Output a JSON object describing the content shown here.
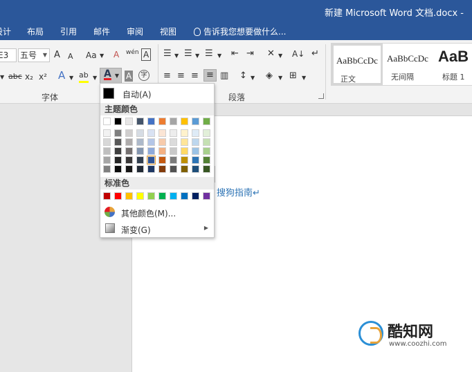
{
  "window": {
    "title": "新建 Microsoft Word 文档.docx -"
  },
  "tabs": [
    {
      "label": "设计"
    },
    {
      "label": "布局"
    },
    {
      "label": "引用"
    },
    {
      "label": "邮件"
    },
    {
      "label": "审阅"
    },
    {
      "label": "视图"
    }
  ],
  "tell_me": "告诉我您想要做什么...",
  "ribbon": {
    "font_name": "E3",
    "font_size": "五号",
    "grow_font": "A",
    "shrink_font": "A",
    "change_case": "Aa",
    "clear_format": "A",
    "phonetic": "wén",
    "border_char": "A",
    "strikethrough": "abc",
    "subscript": "x₂",
    "superscript": "x²",
    "text_effect": "A",
    "highlight": "ab",
    "font_color": "A",
    "char_shading": "A",
    "enclose_char": "字",
    "sort": "A↓",
    "group_font": "字体",
    "group_paragraph": "段落"
  },
  "styles": [
    {
      "sample": "AaBbCcDc",
      "name": "正文",
      "selected": true
    },
    {
      "sample": "AaBbCcDc",
      "name": "无间隔",
      "selected": false
    },
    {
      "sample": "AaB",
      "name": "标题 1",
      "selected": false
    }
  ],
  "document": {
    "text": "搜狗指南"
  },
  "color_menu": {
    "auto_label": "自动(A)",
    "theme_header": "主题颜色",
    "standard_header": "标准色",
    "more_colors": "其他颜色(M)...",
    "gradient": "渐变(G)",
    "theme_top": [
      "#ffffff",
      "#000000",
      "#e7e6e6",
      "#44546a",
      "#4472c4",
      "#ed7d31",
      "#a5a5a5",
      "#ffc000",
      "#5b9bd5",
      "#70ad47"
    ],
    "theme_shades": [
      [
        "#f2f2f2",
        "#7f7f7f",
        "#d0cece",
        "#d6dce4",
        "#d9e2f3",
        "#fbe5d5",
        "#ededed",
        "#fff2cc",
        "#deebf6",
        "#e2efd9"
      ],
      [
        "#d8d8d8",
        "#595959",
        "#aeabab",
        "#adb9ca",
        "#b4c6e7",
        "#f7cbac",
        "#dbdbdb",
        "#fee599",
        "#bdd7ee",
        "#c5e0b3"
      ],
      [
        "#bfbfbf",
        "#3f3f3f",
        "#757070",
        "#8496b0",
        "#8eaadb",
        "#f4b183",
        "#c9c9c9",
        "#ffd965",
        "#9cc3e5",
        "#a8d08d"
      ],
      [
        "#a5a5a5",
        "#262626",
        "#3a3838",
        "#323f4f",
        "#2f5496",
        "#c55a11",
        "#7b7b7b",
        "#bf9000",
        "#2e75b5",
        "#538135"
      ],
      [
        "#7f7f7f",
        "#0c0c0c",
        "#171616",
        "#222a35",
        "#1f3864",
        "#833c0b",
        "#525252",
        "#7f6000",
        "#1e4e79",
        "#375623"
      ]
    ],
    "standard": [
      "#c00000",
      "#ff0000",
      "#ffc000",
      "#ffff00",
      "#92d050",
      "#00b050",
      "#00b0f0",
      "#0070c0",
      "#002060",
      "#7030a0"
    ]
  },
  "watermark": {
    "name": "酷知网",
    "url": "www.coozhi.com"
  }
}
